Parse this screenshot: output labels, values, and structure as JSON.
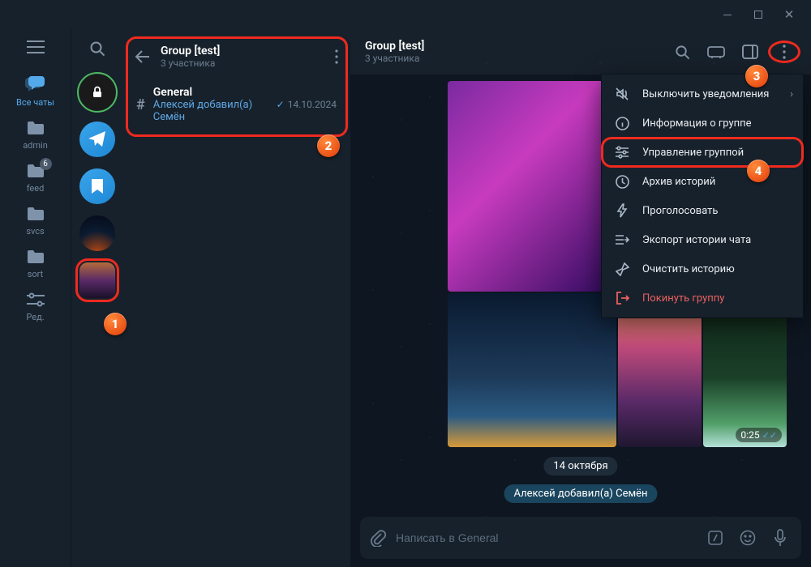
{
  "rail": {
    "folders": [
      {
        "id": "all",
        "label": "Все чаты"
      },
      {
        "id": "admin",
        "label": "admin"
      },
      {
        "id": "feed",
        "label": "feed",
        "badge": "6"
      },
      {
        "id": "svcs",
        "label": "svcs"
      },
      {
        "id": "sort",
        "label": "sort"
      },
      {
        "id": "edit",
        "label": "Ред."
      }
    ]
  },
  "group_panel": {
    "title": "Group [test]",
    "members": "3 участника",
    "channel": {
      "name": "General",
      "subtitle": "Алексей добавил(а) Семён",
      "date": "14.10.2024"
    }
  },
  "chat_header": {
    "title": "Group [test]",
    "members": "3 участника"
  },
  "menu": {
    "items": [
      {
        "id": "mute",
        "label": "Выключить уведомления",
        "chevron": true
      },
      {
        "id": "info",
        "label": "Информация о группе"
      },
      {
        "id": "manage",
        "label": "Управление группой",
        "highlight": true
      },
      {
        "id": "stories",
        "label": "Архив историй"
      },
      {
        "id": "boost",
        "label": "Проголосовать"
      },
      {
        "id": "export",
        "label": "Экспорт истории чата"
      },
      {
        "id": "clear",
        "label": "Очистить историю"
      },
      {
        "id": "leave",
        "label": "Покинуть группу",
        "danger": true
      }
    ]
  },
  "messages": {
    "date_label": "14 октября",
    "system_label": "Алексей добавил(а) Семён",
    "video_duration": "0:25"
  },
  "input": {
    "placeholder": "Написать в General"
  },
  "markers": [
    "1",
    "2",
    "3",
    "4"
  ]
}
